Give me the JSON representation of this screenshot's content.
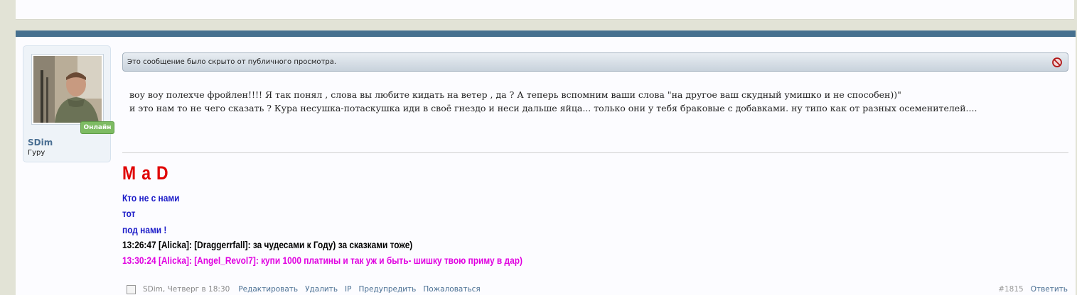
{
  "user": {
    "name": "SDim",
    "title": "Гуру",
    "status": "Онлайн"
  },
  "notice": "Это сообщение было скрыто от публичного просмотра.",
  "message": {
    "line1": "воу воу полехче фройлен!!!! Я так понял , слова вы любите кидать на ветер , да ? А теперь вспомним ваши слова \"на другое ваш скудный умишко и не способен))\"",
    "line2": "и это нам то не чего сказать ? Кура несушка-потаскушка иди в своё гнездо и неси дальше яйца... только они у тебя браковые с добавками. ну типо как от разных осеменителей...."
  },
  "signature": {
    "big": "M a D",
    "l1": "Кто не с нами",
    "l2": "тот",
    "l3": "под нами !",
    "l4": "13:26:47 [Alicka]: [Draggerrfall]: за чудесами к Году) за сказками тоже)",
    "l5": "13:30:24 [Alicka]: [Angel_Revol7]: купи 1000 платины и так уж и быть- шишку твою приму в дар)"
  },
  "footer": {
    "meta": "SDim, Четверг в 18:30",
    "edit": "Редактировать",
    "delete": "Удалить",
    "ip": "IP",
    "warn": "Предупредить",
    "report": "Пожаловаться",
    "post_number": "#1815",
    "reply": "Ответить"
  },
  "colors": {
    "header_bar": "#46708f",
    "sig_red": "#e00000",
    "sig_blue": "#1b1bc8",
    "sig_magenta": "#e000e0",
    "online": "#7dbb62"
  }
}
